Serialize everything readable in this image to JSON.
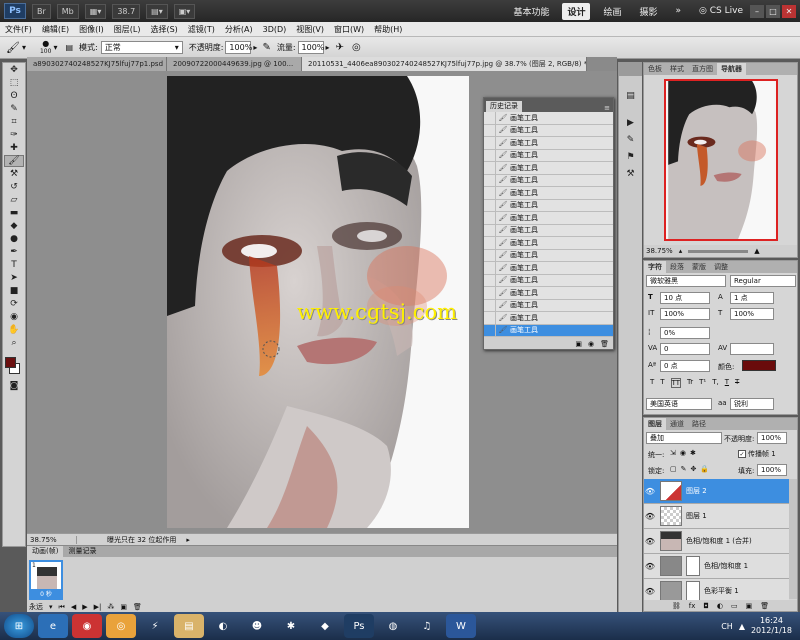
{
  "app": {
    "logo": "Ps",
    "zoom": "38.7",
    "workspaces": [
      "基本功能",
      "设计",
      "绘画",
      "摄影"
    ],
    "active_workspace": "设计",
    "cslive": "CS Live"
  },
  "menu": [
    "文件(F)",
    "编辑(E)",
    "图像(I)",
    "图层(L)",
    "选择(S)",
    "滤镜(T)",
    "分析(A)",
    "3D(D)",
    "视图(V)",
    "窗口(W)",
    "帮助(H)"
  ],
  "options": {
    "brush_size": "100",
    "mode_label": "模式:",
    "mode_value": "正常",
    "opacity_label": "不透明度:",
    "opacity_value": "100%",
    "flow_label": "流量:",
    "flow_value": "100%"
  },
  "doc_tabs": [
    {
      "label": "a890302740248527KJ75lfuj77p1.psd",
      "active": false
    },
    {
      "label": "20090722000449639.jpg @ 100...",
      "active": false
    },
    {
      "label": "20110531_4406ea890302740248527KJ75lfuj77p.jpg @ 38.7% (图层 2, RGB/8) *",
      "active": true
    }
  ],
  "status": {
    "zoom": "38.75%",
    "info": "曝光只在 32 位起作用"
  },
  "watermark": "www.cgtsj.com",
  "history": {
    "title": "历史记录",
    "items": [
      "画笔工具",
      "画笔工具",
      "画笔工具",
      "画笔工具",
      "画笔工具",
      "画笔工具",
      "画笔工具",
      "画笔工具",
      "画笔工具",
      "画笔工具",
      "画笔工具",
      "画笔工具",
      "画笔工具",
      "画笔工具",
      "画笔工具",
      "画笔工具",
      "画笔工具",
      "画笔工具"
    ]
  },
  "timeline": {
    "tabs": [
      "动画(帧)",
      "测量记录"
    ],
    "frame_delay": "0 秒",
    "loop": "永远"
  },
  "navigator": {
    "tabs": [
      "色板",
      "样式",
      "直方图",
      "导航器"
    ],
    "zoom": "38.75%"
  },
  "character": {
    "tabs": [
      "字符",
      "段落",
      "蒙版",
      "调整"
    ],
    "font": "微软雅黑",
    "style": "Regular",
    "size": "10 点",
    "leading": "1 点",
    "vscale": "100%",
    "hscale": "100%",
    "tracking_pct": "0%",
    "tracking": "0",
    "baseline": "0 点",
    "color_label": "颜色:",
    "language": "美国英语",
    "aa_icon": "aa",
    "aa": "锐利",
    "style_buttons": [
      "T",
      "T",
      "TT",
      "Tr",
      "T¹",
      "T,",
      "T",
      "T"
    ]
  },
  "layers": {
    "tabs": [
      "图层",
      "通道",
      "路径"
    ],
    "blend": "叠加",
    "opacity_label": "不透明度:",
    "opacity": "100%",
    "unify_label": "统一:",
    "propagate_label": "传播帧 1",
    "lock_label": "锁定:",
    "fill_label": "填充:",
    "fill": "100%",
    "items": [
      {
        "name": "图层 2",
        "selected": true
      },
      {
        "name": "图层 1",
        "selected": false
      },
      {
        "name": "色相/饱和度 1 (合并)",
        "selected": false
      },
      {
        "name": "色相/饱和度 1",
        "selected": false
      },
      {
        "name": "色彩平衡 1",
        "selected": false
      }
    ]
  },
  "taskbar": {
    "time": "16:24",
    "date": "2012/1/18"
  },
  "colors": {
    "accent": "#3d8ee0",
    "foreground": "#6b1010",
    "background": "#ffffff",
    "text_color": "#6a0b0b"
  }
}
